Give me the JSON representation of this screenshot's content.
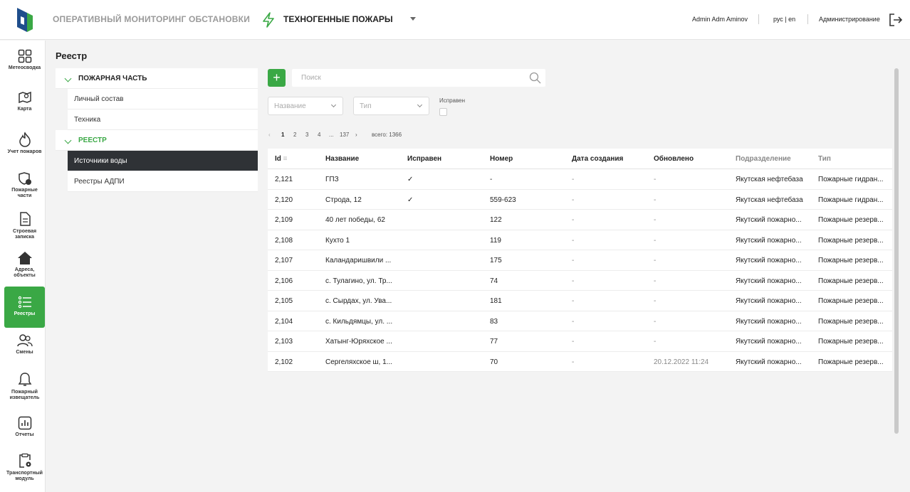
{
  "header": {
    "app_title": "ОПЕРАТИВНЫЙ МОНИТОРИНГ ОБСТАНОВКИ",
    "module_title": "ТЕХНОГЕННЫЕ ПОЖАРЫ",
    "user": "Admin Adm Aminov",
    "lang": "рус | en",
    "admin_link": "Администрирование",
    "accent_color": "#3aa845"
  },
  "sidebar": {
    "items": [
      {
        "label": "Метеосводка",
        "icon": "dashboard-icon"
      },
      {
        "label": "Карта",
        "icon": "map-icon"
      },
      {
        "label": "Учет пожаров",
        "icon": "fire-icon"
      },
      {
        "label": "Пожарные части",
        "icon": "shield-icon"
      },
      {
        "label": "Строевая записка",
        "icon": "document-icon"
      },
      {
        "label": "Адреса, объекты",
        "icon": "home-icon"
      },
      {
        "label": "Реестры",
        "icon": "list-icon"
      },
      {
        "label": "Смены",
        "icon": "users-icon"
      },
      {
        "label": "Пожарный извещатель",
        "icon": "bell-icon"
      },
      {
        "label": "Отчеты",
        "icon": "bar-chart-icon"
      },
      {
        "label": "Транспортный модуль",
        "icon": "clipboard-gear-icon"
      }
    ]
  },
  "page": {
    "title": "Реестр"
  },
  "tree": {
    "group1": "ПОЖАРНАЯ ЧАСТЬ",
    "group1_items": [
      "Личный состав",
      "Техника"
    ],
    "group2": "РЕЕСТР",
    "group2_items": [
      "Источники воды",
      "Реестры АДПИ"
    ]
  },
  "toolbar": {
    "add_label": "+",
    "search_placeholder": "Поиск",
    "filter_name_placeholder": "Название",
    "filter_type_placeholder": "Тип",
    "checkbox_label": "Исправен"
  },
  "pager": {
    "prev": "‹",
    "pages": [
      "1",
      "2",
      "3",
      "4",
      "...",
      "137"
    ],
    "next": "›",
    "total": "всего: 1366"
  },
  "table": {
    "columns": [
      "Id",
      "Название",
      "Исправен",
      "Номер",
      "Дата создания",
      "Обновлено",
      "Подразделение",
      "Тип"
    ],
    "rows": [
      [
        "2,121",
        "ГПЗ",
        "✓",
        "-",
        "-",
        "-",
        "Якутская нефтебаза",
        "Пожарные гидран..."
      ],
      [
        "2,120",
        "Строда, 12",
        "✓",
        "559-623",
        "-",
        "-",
        "Якутская нефтебаза",
        "Пожарные гидран..."
      ],
      [
        "2,109",
        "40 лет победы, 62",
        "",
        "122",
        "-",
        "-",
        "Якутский пожарно...",
        "Пожарные резерв..."
      ],
      [
        "2,108",
        "Кухто 1",
        "",
        "119",
        "-",
        "-",
        "Якутский пожарно...",
        "Пожарные резерв..."
      ],
      [
        "2,107",
        "Каландаришвили ...",
        "",
        "175",
        "-",
        "-",
        "Якутский пожарно...",
        "Пожарные резерв..."
      ],
      [
        "2,106",
        "с. Тулагино, ул. Тр...",
        "",
        "74",
        "-",
        "-",
        "Якутский пожарно...",
        "Пожарные резерв..."
      ],
      [
        "2,105",
        "с. Сырдах, ул. Ува...",
        "",
        "181",
        "-",
        "-",
        "Якутский пожарно...",
        "Пожарные резерв..."
      ],
      [
        "2,104",
        "с. Кильдямцы, ул. ...",
        "",
        "83",
        "-",
        "-",
        "Якутский пожарно...",
        "Пожарные резерв..."
      ],
      [
        "2,103",
        "Хатынг-Юряхское ...",
        "",
        "77",
        "-",
        "-",
        "Якутский пожарно...",
        "Пожарные резерв..."
      ],
      [
        "2,102",
        "Сергеляхское ш, 1...",
        "",
        "70",
        "-",
        "20.12.2022 11:24",
        "Якутский пожарно...",
        "Пожарные резерв..."
      ]
    ]
  }
}
